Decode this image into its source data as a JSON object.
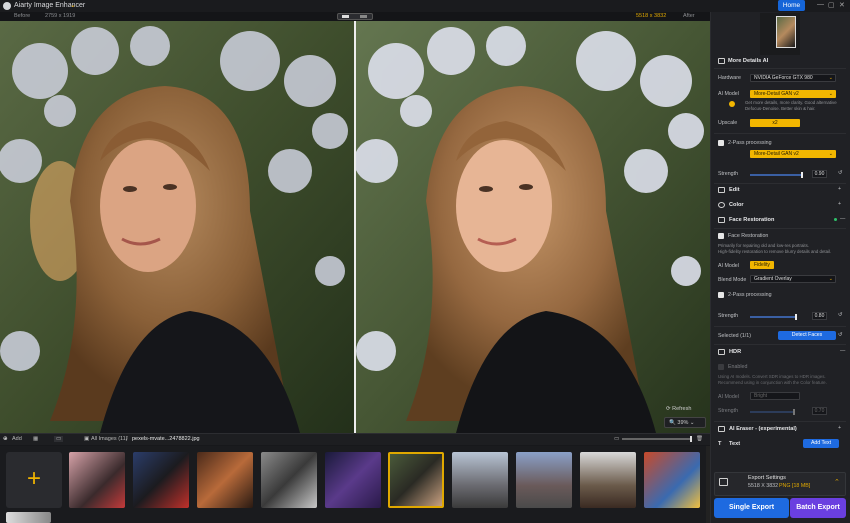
{
  "app": {
    "title": "Aiarty Image Enhancer",
    "home_label": "Home"
  },
  "preview": {
    "before_label": "Before",
    "before_size": "2759 x 1919",
    "after_size": "5518 x 3832",
    "after_label": "After",
    "refresh_label": "Refresh",
    "zoom_level": "39%"
  },
  "bottom": {
    "add_label": "Add",
    "all_images": "All Images (11)",
    "separator": "/",
    "current_file": "pexels-mvate...2478822.jpg"
  },
  "sidebar": {
    "more_details": {
      "title": "More Details AI",
      "hardware_label": "Hardware",
      "hardware_value": "NVIDIA GeForce GTX 980",
      "ai_model_label": "AI Model",
      "ai_model_value": "More-Detail GAN  v2",
      "model_hint_1": "Get more details, more clarity. Good alternative",
      "model_hint_2": "Defocus-Denoise. Better skin & hair.",
      "upscale_label": "Upscale",
      "upscale_value": "x2",
      "two_pass_label": "2-Pass processing",
      "two_pass_model": "More-Detail GAN  v2",
      "strength_label": "Strength",
      "strength_value": "0.90",
      "strength_fraction": 0.9
    },
    "sections": {
      "edit": "Edit",
      "color": "Color"
    },
    "face": {
      "title": "Face Restoration",
      "enable_label": "Face Restoration",
      "desc_1": "Primarily for repairing old and low-res portraits.",
      "desc_2": "High-fidelity restoration to remove blurry details and detail.",
      "ai_model_label": "AI Model",
      "ai_model_value": "Fidelity",
      "blend_label": "Blend Mode",
      "blend_value": "Gradient Overlay",
      "two_pass_label": "2-Pass processing",
      "strength_label": "Strength",
      "strength_value": "0.80",
      "strength_fraction": 0.8,
      "selected_label": "Selected (1/1)",
      "detect_label": "Detect Faces"
    },
    "hdr": {
      "title": "HDR",
      "enable_label": "Enabled",
      "desc_1": "Using AI models. Convert SDR images to HDR images.",
      "desc_2": "Recommend using in conjunction with the Color feature.",
      "mode_label": "AI Model",
      "mode_value": "Bright",
      "strength_label": "Strength",
      "strength_value": "0.70"
    },
    "eraser": {
      "title": "AI Eraser - (experimental)"
    },
    "text": {
      "title": "Text",
      "add_label": "Add Text"
    },
    "export": {
      "title": "Export Settings",
      "size": "5518 X 3832",
      "format": "PNG",
      "filesize": "[18 MB]",
      "single_label": "Single Export",
      "batch_label": "Batch Export"
    }
  },
  "colors": {
    "accent_yellow": "#f2b600",
    "accent_blue": "#1e6ae0",
    "accent_purple": "#6a3fe0"
  }
}
